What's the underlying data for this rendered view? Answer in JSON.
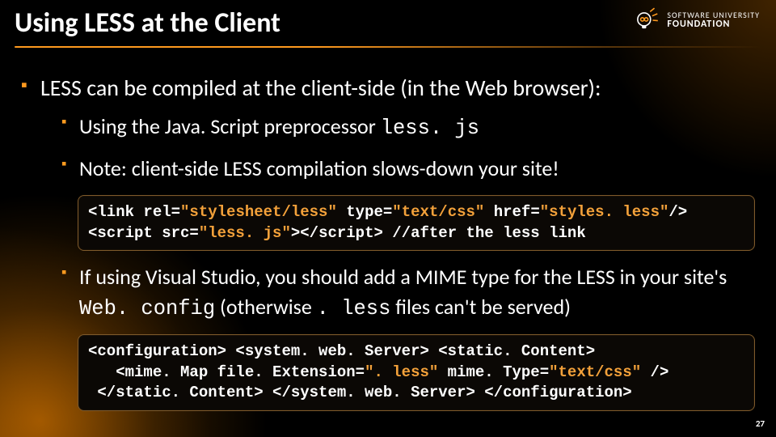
{
  "logo": {
    "line1": "SOFTWARE UNIVERSITY",
    "line2": "FOUNDATION"
  },
  "title": "Using LESS at the Client",
  "bullets": {
    "b1": "LESS can be compiled at the client-side (in the Web browser):",
    "b1a_pre": "Using the Java. Script preprocessor ",
    "b1a_code": "less. js",
    "b1b": "Note: client-side LESS compilation slows-down your site!",
    "b1c_pre": "If using Visual Studio, you should add a MIME type for the LESS in your site's ",
    "b1c_code1": "Web. config",
    "b1c_mid": " (otherwise ",
    "b1c_code2": ". less",
    "b1c_post": " files can't be served)"
  },
  "code1": {
    "l1a": "<link rel=",
    "l1b": "\"stylesheet/less\"",
    "l1c": " type=",
    "l1d": "\"text/css\"",
    "l1e": " href=",
    "l1f": "\"styles. less\"",
    "l1g": "/>",
    "l2a": "<script src=",
    "l2b": "\"less. js\"",
    "l2c": "></script> //after the less link"
  },
  "code2": {
    "l1": "<configuration> <system. web. Server> <static. Content>",
    "l2a": "   <mime. Map file. Extension=",
    "l2b": "\". less\"",
    "l2c": " mime. Type=",
    "l2d": "\"text/css\"",
    "l2e": " />",
    "l3": " </static. Content> </system. web. Server> </configuration>"
  },
  "pagenum": "27"
}
